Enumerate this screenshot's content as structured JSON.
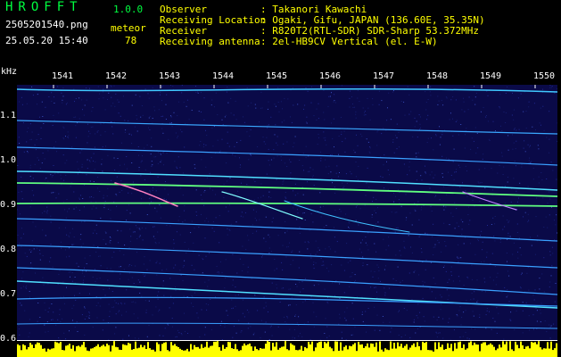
{
  "app": {
    "name": "HROFFT",
    "version": "1.0.0",
    "filename": "2505201540.png",
    "datetime": "25.05.20 15:40",
    "meteor_label": "meteor",
    "meteor_count": "78"
  },
  "info": {
    "observer_label": "Observer",
    "observer_value": ": Takanori Kawachi",
    "location_label": "Receiving Location",
    "location_value": ": Ogaki, Gifu, JAPAN (136.60E, 35.35N)",
    "receiver_label": "Receiver",
    "receiver_value": ": R820T2(RTL-SDR) SDR-Sharp 53.372MHz",
    "antenna_label": "Receiving antenna",
    "antenna_value": ": 2el-HB9CV Vertical (el. E-W)"
  },
  "axes": {
    "y_unit": "kHz",
    "x_ticks": [
      "1541",
      "1542",
      "1543",
      "1544",
      "1545",
      "1546",
      "1547",
      "1548",
      "1549",
      "1550"
    ],
    "y_ticks": [
      "1.1",
      "1.0",
      "0.9",
      "0.8",
      "0.7",
      "0.6"
    ]
  },
  "colors": {
    "background": "#0a0a48",
    "trace": "#40d0ff",
    "carrier": "#60ff80",
    "amplitude": "#ffff00"
  }
}
